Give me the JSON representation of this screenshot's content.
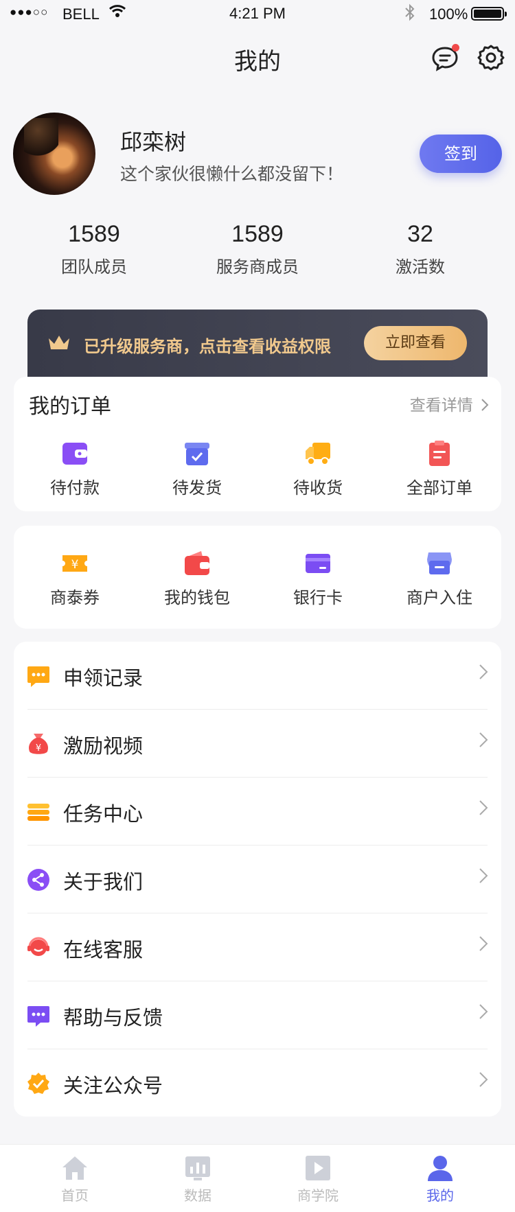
{
  "status_bar": {
    "signal": "●●●○○",
    "carrier": "BELL",
    "time": "4:21 PM",
    "battery": "100%"
  },
  "header": {
    "title": "我的"
  },
  "profile": {
    "name": "邱栾树",
    "bio": "这个家伙很懒什么都没留下！",
    "signin_label": "签到"
  },
  "stats": [
    {
      "value": "1589",
      "label": "团队成员"
    },
    {
      "value": "1589",
      "label": "服务商成员"
    },
    {
      "value": "32",
      "label": "激活数"
    }
  ],
  "vip_banner": {
    "text": "已升级服务商，点击查看收益权限",
    "button": "立即查看"
  },
  "orders": {
    "title": "我的订单",
    "detail_link": "查看详情",
    "items": [
      {
        "label": "待付款",
        "icon": "wallet-icon"
      },
      {
        "label": "待发货",
        "icon": "box-check-icon"
      },
      {
        "label": "待收货",
        "icon": "truck-icon"
      },
      {
        "label": "全部订单",
        "icon": "clipboard-icon"
      }
    ]
  },
  "wallet": {
    "items": [
      {
        "label": "商泰券",
        "icon": "coupon-icon"
      },
      {
        "label": "我的钱包",
        "icon": "purse-icon"
      },
      {
        "label": "银行卡",
        "icon": "bank-card-icon"
      },
      {
        "label": "商户入住",
        "icon": "store-icon"
      }
    ]
  },
  "menu": {
    "items": [
      {
        "label": "申领记录",
        "icon": "chat-dots-icon"
      },
      {
        "label": "激励视频",
        "icon": "money-bag-icon"
      },
      {
        "label": "任务中心",
        "icon": "stack-icon"
      },
      {
        "label": "关于我们",
        "icon": "share-icon"
      },
      {
        "label": "在线客服",
        "icon": "headset-icon"
      },
      {
        "label": "帮助与反馈",
        "icon": "message-icon"
      },
      {
        "label": "关注公众号",
        "icon": "verified-badge-icon"
      }
    ]
  },
  "tab_bar": {
    "tabs": [
      {
        "label": "首页",
        "icon": "home-icon",
        "active": false
      },
      {
        "label": "数据",
        "icon": "bar-chart-icon",
        "active": false
      },
      {
        "label": "商学院",
        "icon": "play-icon",
        "active": false
      },
      {
        "label": "我的",
        "icon": "user-icon",
        "active": true
      }
    ]
  },
  "colors": {
    "accent": "#5a66ea",
    "gold": "#f1c98d",
    "background": "#f6f6f8"
  }
}
